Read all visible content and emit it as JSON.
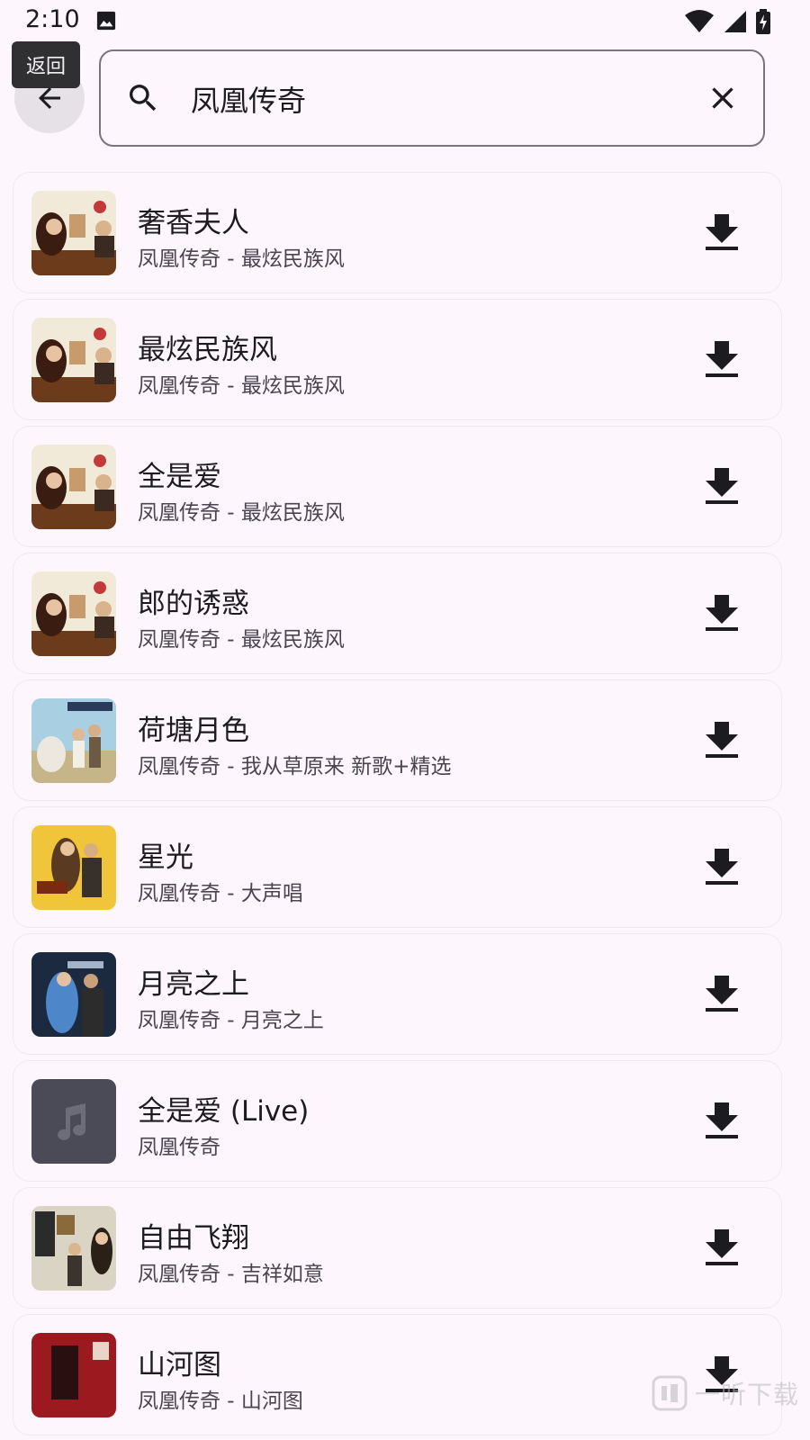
{
  "status_bar": {
    "time": "2:10",
    "icons": [
      "image-icon",
      "wifi-icon",
      "signal-icon",
      "battery-charging-icon"
    ]
  },
  "header": {
    "back_tooltip": "返回",
    "search": {
      "value": "凤凰传奇",
      "placeholder": ""
    }
  },
  "songs": [
    {
      "title": "奢香夫人",
      "subtitle": "凤凰传奇 - 最炫民族风",
      "cover": "album-zuixuan-cover"
    },
    {
      "title": "最炫民族风",
      "subtitle": "凤凰传奇 - 最炫民族风",
      "cover": "album-zuixuan-cover"
    },
    {
      "title": "全是爱",
      "subtitle": "凤凰传奇 - 最炫民族风",
      "cover": "album-zuixuan-cover"
    },
    {
      "title": "郎的诱惑",
      "subtitle": "凤凰传奇 - 最炫民族风",
      "cover": "album-zuixuan-cover"
    },
    {
      "title": "荷塘月色",
      "subtitle": "凤凰传奇 - 我从草原来 新歌+精选",
      "cover": "album-caoyuan-cover"
    },
    {
      "title": "星光",
      "subtitle": "凤凰传奇 - 大声唱",
      "cover": "album-dashengchang-cover"
    },
    {
      "title": "月亮之上",
      "subtitle": "凤凰传奇 - 月亮之上",
      "cover": "album-yueliang-cover"
    },
    {
      "title": "全是爱 (Live)",
      "subtitle": "凤凰传奇",
      "cover": "music-note-placeholder-icon"
    },
    {
      "title": "自由飞翔",
      "subtitle": "凤凰传奇 - 吉祥如意",
      "cover": "album-jixiang-cover"
    },
    {
      "title": "山河图",
      "subtitle": "凤凰传奇 - 山河图",
      "cover": "album-shanhetu-cover"
    }
  ],
  "watermark": {
    "text": "一听下载"
  },
  "colors": {
    "background": "#fdf7fd",
    "tooltip_bg": "#303033",
    "back_button_bg": "#e6e1e6",
    "outline": "#79747e",
    "icon": "#1c1b1f"
  }
}
